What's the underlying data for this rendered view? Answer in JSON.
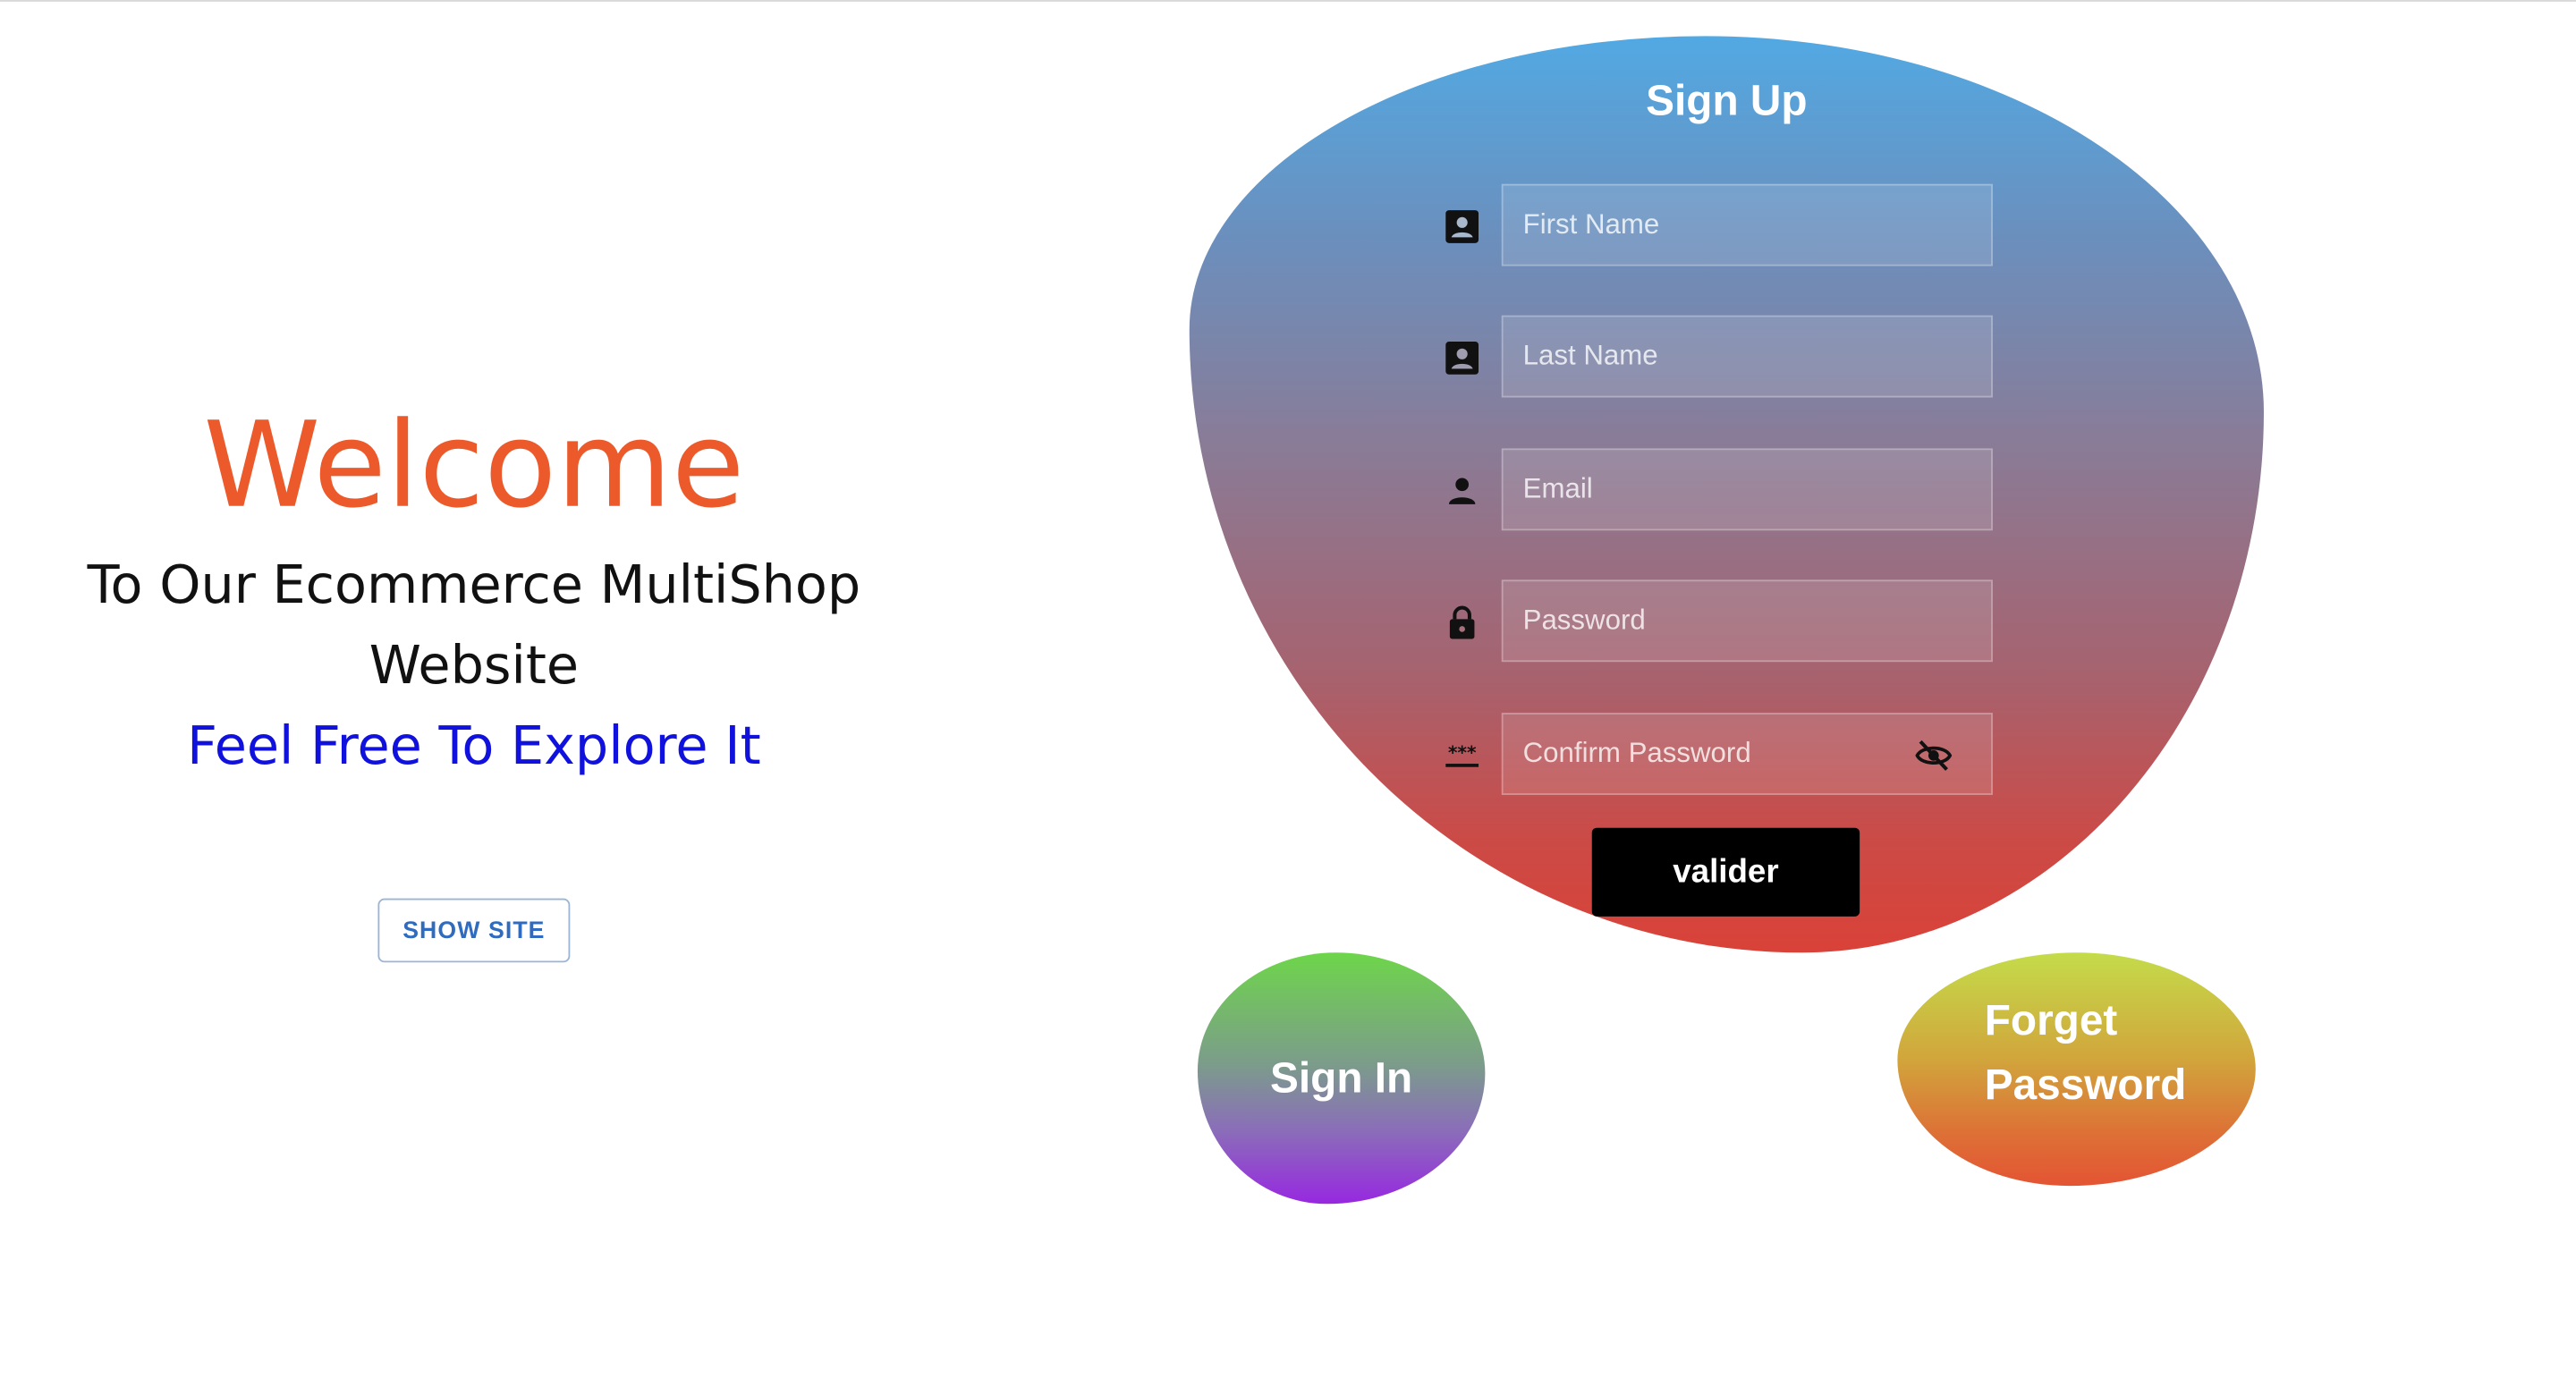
{
  "welcome": {
    "title": "Welcome",
    "subtitle": "To Our Ecommerce MultiShop Website",
    "explore": "Feel Free To Explore It",
    "show_site_label": "SHOW SITE"
  },
  "signup": {
    "title": "Sign Up",
    "fields": [
      {
        "placeholder": "First Name",
        "icon": "contact-card-icon",
        "type": "text"
      },
      {
        "placeholder": "Last Name",
        "icon": "contact-card-icon",
        "type": "text"
      },
      {
        "placeholder": "Email",
        "icon": "person-icon",
        "type": "email"
      },
      {
        "placeholder": "Password",
        "icon": "lock-icon",
        "type": "password"
      },
      {
        "placeholder": "Confirm Password",
        "icon": "password-dots-icon",
        "type": "password"
      }
    ],
    "visibility_toggle_icon": "eye-off-icon",
    "submit_label": "valider"
  },
  "nav": {
    "signin_label": "Sign In",
    "forget_password_label": "Forget Password"
  },
  "colors": {
    "welcome_title": "#ec5a2c",
    "explore_text": "#1111dd",
    "show_site_text": "#2f6cc0",
    "signup_gradient_top": "#52a9e3",
    "signup_gradient_bottom": "#d94238",
    "signin_gradient_top": "#6ed64a",
    "signin_gradient_bottom": "#9728e0",
    "forget_gradient_top": "#c4dc4a",
    "forget_gradient_bottom": "#e45433",
    "submit_bg": "#000000"
  }
}
